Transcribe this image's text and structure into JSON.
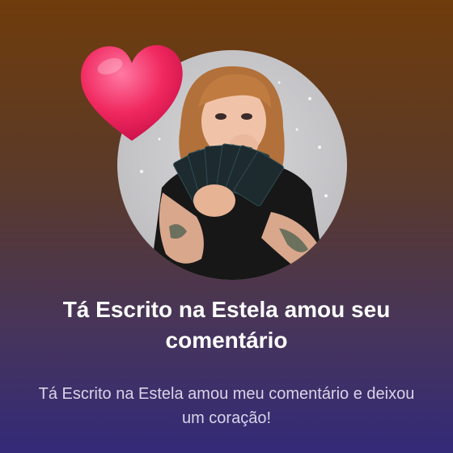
{
  "notification": {
    "title": "Tá Escrito na Estela amou seu comentário",
    "message": "Tá Escrito na Estela amou meu comentário e deixou um coração!",
    "icon": "heart-icon",
    "avatar": "profile-avatar"
  },
  "colors": {
    "heart": "#f0285f",
    "background_top": "#6f3c0b",
    "background_bottom": "#332a78"
  }
}
